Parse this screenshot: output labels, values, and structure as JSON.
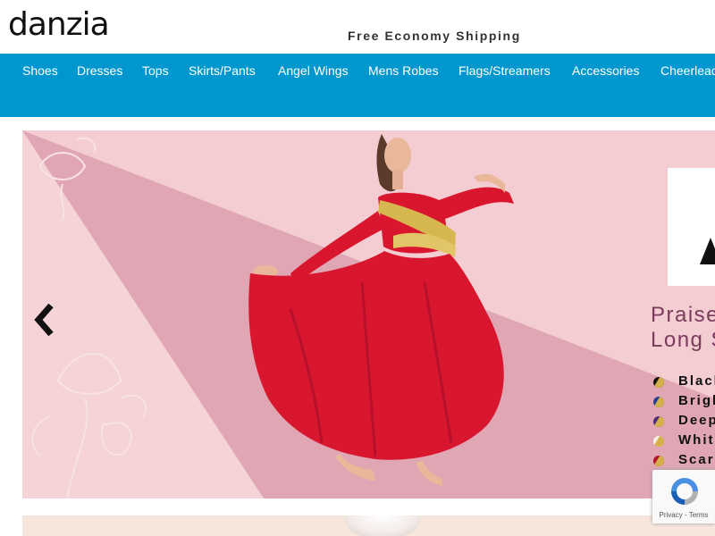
{
  "header": {
    "logo_text": "danzia",
    "promo_text": "Free Economy Shipping"
  },
  "nav": {
    "items": [
      {
        "label": "Shoes"
      },
      {
        "label": "Dresses"
      },
      {
        "label": "Tops"
      },
      {
        "label": "Skirts/Pants"
      },
      {
        "label": "Angel Wings"
      },
      {
        "label": "Mens Robes"
      },
      {
        "label": "Flags/Streamers"
      },
      {
        "label": "Accessories"
      },
      {
        "label": "Cheerleading"
      }
    ],
    "background_color": "#0097cf"
  },
  "banner": {
    "title_initial": "A",
    "subtitle_line1": "Praise",
    "subtitle_line2": "Long S",
    "color_options": [
      {
        "label": "Black",
        "colors": [
          "#111111",
          "#d4b04a"
        ]
      },
      {
        "label": "Bright",
        "colors": [
          "#1f3f9a",
          "#d4b04a"
        ]
      },
      {
        "label": "Deep",
        "colors": [
          "#4a2c7a",
          "#d4b04a"
        ]
      },
      {
        "label": "White",
        "colors": [
          "#f4f0e6",
          "#d4b04a"
        ]
      },
      {
        "label": "Scarlet",
        "colors": [
          "#b3122a",
          "#d4b04a"
        ]
      }
    ],
    "dress_color": "#d8172f",
    "accent_color": "#d6b64f"
  },
  "recaptcha": {
    "links": "Privacy - Terms"
  }
}
